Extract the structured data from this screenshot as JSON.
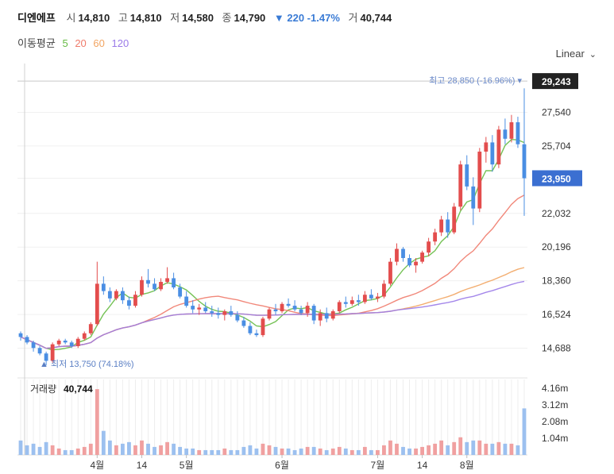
{
  "header": {
    "name": "디엔에프",
    "open_label": "시",
    "open": "14,810",
    "high_label": "고",
    "high": "14,810",
    "low_label": "저",
    "low": "14,580",
    "close_label": "종",
    "close": "14,790",
    "change": "▼ 220 -1.47%",
    "volume_label": "거",
    "volume": "40,744"
  },
  "ma_legend": {
    "label": "이동평균",
    "items": [
      {
        "text": "5",
        "color": "#66bb44"
      },
      {
        "text": "20",
        "color": "#ef7b6b"
      },
      {
        "text": "60",
        "color": "#f2a562"
      },
      {
        "text": "120",
        "color": "#9a7ae8"
      }
    ]
  },
  "scale_button": "Linear",
  "colors": {
    "up": "#e34d4d",
    "down": "#4a8ee3",
    "ma5": "#66bb44",
    "ma20": "#ef7b6b",
    "ma60": "#f2a562",
    "ma120": "#9a7ae8"
  },
  "chart_data": {
    "type": "candlestick",
    "price_ticks": [
      "29,243",
      "27,540",
      "25,704",
      "23,950",
      "22,032",
      "20,196",
      "18,360",
      "16,524",
      "14,688"
    ],
    "price_tick_values": [
      29243,
      27540,
      25704,
      23950,
      22032,
      20196,
      18360,
      16524,
      14688
    ],
    "ylim": [
      13500,
      30200
    ],
    "max_annotation": "최고 28,850 (-16.96%)",
    "min_annotation": "▲ 최저 13,750 (74.18%)",
    "max_value": 28850,
    "min_value": 13750,
    "last_price_label": "23,950",
    "top_label": "29,243",
    "x_labels": [
      "4월",
      "14",
      "5월",
      "6월",
      "7월",
      "14",
      "8월"
    ],
    "x_label_index": [
      12,
      19,
      26,
      41,
      56,
      63,
      70
    ],
    "volume_label": "거래량",
    "volume_value": "40,744",
    "volume_ticks": [
      "4.16m",
      "3.12m",
      "2.08m",
      "1.04m"
    ],
    "volume_tick_values": [
      4160000,
      3120000,
      2080000,
      1040000
    ],
    "volume_max": 4700000,
    "candles": [
      [
        15500,
        15600,
        15100,
        15300
      ],
      [
        15300,
        15400,
        14900,
        15000
      ],
      [
        15000,
        15100,
        14500,
        14700
      ],
      [
        14700,
        14800,
        14300,
        14400
      ],
      [
        14400,
        14500,
        13750,
        14000
      ],
      [
        14000,
        15000,
        13900,
        14900
      ],
      [
        14900,
        15200,
        14800,
        15100
      ],
      [
        15100,
        15200,
        14900,
        15000
      ],
      [
        15000,
        15100,
        14700,
        14800
      ],
      [
        14800,
        15300,
        14700,
        15200
      ],
      [
        15200,
        15600,
        15100,
        15500
      ],
      [
        15500,
        16100,
        15400,
        16000
      ],
      [
        16000,
        19400,
        15900,
        18200
      ],
      [
        18200,
        18600,
        17600,
        17800
      ],
      [
        17800,
        18000,
        17200,
        17400
      ],
      [
        17400,
        17900,
        17300,
        17800
      ],
      [
        17800,
        18000,
        17100,
        17300
      ],
      [
        17300,
        17500,
        16800,
        17000
      ],
      [
        17000,
        17800,
        16900,
        17600
      ],
      [
        17600,
        18600,
        17500,
        18400
      ],
      [
        18400,
        19000,
        18000,
        18200
      ],
      [
        18200,
        18500,
        17800,
        17900
      ],
      [
        17900,
        18500,
        17800,
        18300
      ],
      [
        18300,
        19100,
        18200,
        18500
      ],
      [
        18500,
        18800,
        17900,
        18000
      ],
      [
        18000,
        18200,
        17400,
        17500
      ],
      [
        17500,
        17800,
        16900,
        17000
      ],
      [
        17000,
        17300,
        16600,
        16800
      ],
      [
        16800,
        17100,
        16500,
        16900
      ],
      [
        16900,
        17200,
        16600,
        16700
      ],
      [
        16700,
        17000,
        16400,
        16600
      ],
      [
        16600,
        16900,
        16300,
        16500
      ],
      [
        16500,
        16800,
        16200,
        16700
      ],
      [
        16700,
        17000,
        16400,
        16500
      ],
      [
        16500,
        16700,
        16100,
        16200
      ],
      [
        16200,
        16400,
        15800,
        15900
      ],
      [
        15900,
        16100,
        15400,
        15500
      ],
      [
        15500,
        15700,
        15300,
        15400
      ],
      [
        15400,
        16400,
        15300,
        16300
      ],
      [
        16300,
        16900,
        16200,
        16800
      ],
      [
        16800,
        17100,
        16500,
        16700
      ],
      [
        16700,
        17200,
        16600,
        17100
      ],
      [
        17100,
        17400,
        16900,
        17000
      ],
      [
        17000,
        17300,
        16700,
        16800
      ],
      [
        16800,
        17000,
        16500,
        16600
      ],
      [
        16600,
        17200,
        16400,
        17000
      ],
      [
        17000,
        17100,
        16000,
        16200
      ],
      [
        16200,
        16800,
        15900,
        16600
      ],
      [
        16600,
        16900,
        16100,
        16300
      ],
      [
        16300,
        16800,
        16200,
        16700
      ],
      [
        16700,
        17300,
        16600,
        17200
      ],
      [
        17200,
        17500,
        16900,
        17100
      ],
      [
        17100,
        17500,
        17000,
        17300
      ],
      [
        17300,
        17600,
        17000,
        17200
      ],
      [
        17200,
        17800,
        17100,
        17600
      ],
      [
        17600,
        17900,
        17300,
        17400
      ],
      [
        17400,
        17700,
        17200,
        17500
      ],
      [
        17500,
        18400,
        17400,
        18200
      ],
      [
        18200,
        19600,
        18100,
        19400
      ],
      [
        19400,
        20400,
        19200,
        20100
      ],
      [
        20100,
        20200,
        19400,
        19600
      ],
      [
        19600,
        19800,
        19100,
        19200
      ],
      [
        19200,
        19600,
        18800,
        19400
      ],
      [
        19400,
        20000,
        19300,
        19900
      ],
      [
        19900,
        20700,
        19700,
        20500
      ],
      [
        20500,
        21200,
        20300,
        21000
      ],
      [
        21000,
        21900,
        20800,
        21700
      ],
      [
        21700,
        22100,
        20700,
        21000
      ],
      [
        21000,
        22600,
        20900,
        22400
      ],
      [
        22400,
        24900,
        22200,
        24700
      ],
      [
        24700,
        25200,
        23300,
        23500
      ],
      [
        23500,
        24000,
        21400,
        22300
      ],
      [
        22300,
        25600,
        22100,
        25400
      ],
      [
        25400,
        26200,
        24800,
        25900
      ],
      [
        25900,
        26300,
        24300,
        24700
      ],
      [
        24700,
        26800,
        24500,
        26600
      ],
      [
        26600,
        27200,
        25800,
        26100
      ],
      [
        26100,
        27400,
        25900,
        27000
      ],
      [
        27000,
        27300,
        25600,
        25800
      ],
      [
        25800,
        28850,
        21900,
        23950
      ]
    ],
    "volumes": [
      900000,
      600000,
      700000,
      500000,
      800000,
      600000,
      400000,
      300000,
      300000,
      400000,
      500000,
      700000,
      4100000,
      1500000,
      900000,
      600000,
      700000,
      800000,
      600000,
      900000,
      700000,
      500000,
      600000,
      800000,
      700000,
      500000,
      400000,
      400000,
      300000,
      300000,
      300000,
      300000,
      400000,
      300000,
      300000,
      500000,
      600000,
      400000,
      700000,
      600000,
      500000,
      400000,
      400000,
      300000,
      400000,
      500000,
      500000,
      400000,
      300000,
      400000,
      500000,
      400000,
      300000,
      300000,
      500000,
      300000,
      300000,
      600000,
      900000,
      700000,
      500000,
      400000,
      400000,
      500000,
      600000,
      700000,
      900000,
      600000,
      800000,
      1100000,
      800000,
      900000,
      900000,
      700000,
      700000,
      800000,
      700000,
      700000,
      600000,
      2900000
    ]
  }
}
